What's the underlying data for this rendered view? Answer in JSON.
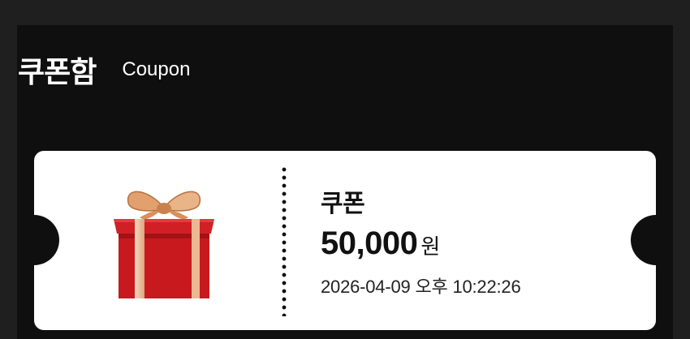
{
  "header": {
    "title_ko": "쿠폰함",
    "title_en": "Coupon"
  },
  "coupon": {
    "icon": "gift-box-icon",
    "name": "쿠폰",
    "amount": "50,000",
    "unit": "원",
    "date": "2026-04-09 오후 10:22:26"
  },
  "colors": {
    "background": "#1f1f1f",
    "panel": "#0f0f0f",
    "card": "#ffffff",
    "gift_red": "#c8191f",
    "ribbon_gold": "#e3a57a"
  }
}
